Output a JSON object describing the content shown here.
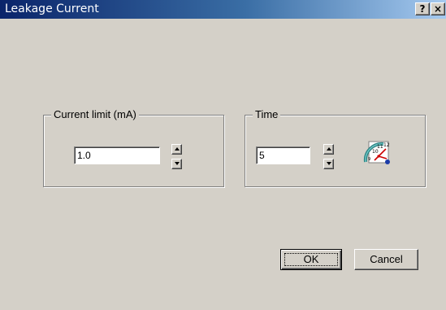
{
  "window": {
    "title": "Leakage Current",
    "help_label": "?",
    "close_label": "×"
  },
  "current_group": {
    "label": "Current limit (mA)",
    "value": "1.0"
  },
  "time_group": {
    "label": "Time",
    "value": "5",
    "icon": "clock-gauge-icon"
  },
  "buttons": {
    "ok": "OK",
    "cancel": "Cancel"
  },
  "colors": {
    "titlebar_start": "#0a246a",
    "titlebar_end": "#a6caf0",
    "dialog_face": "#d4d0c8"
  }
}
